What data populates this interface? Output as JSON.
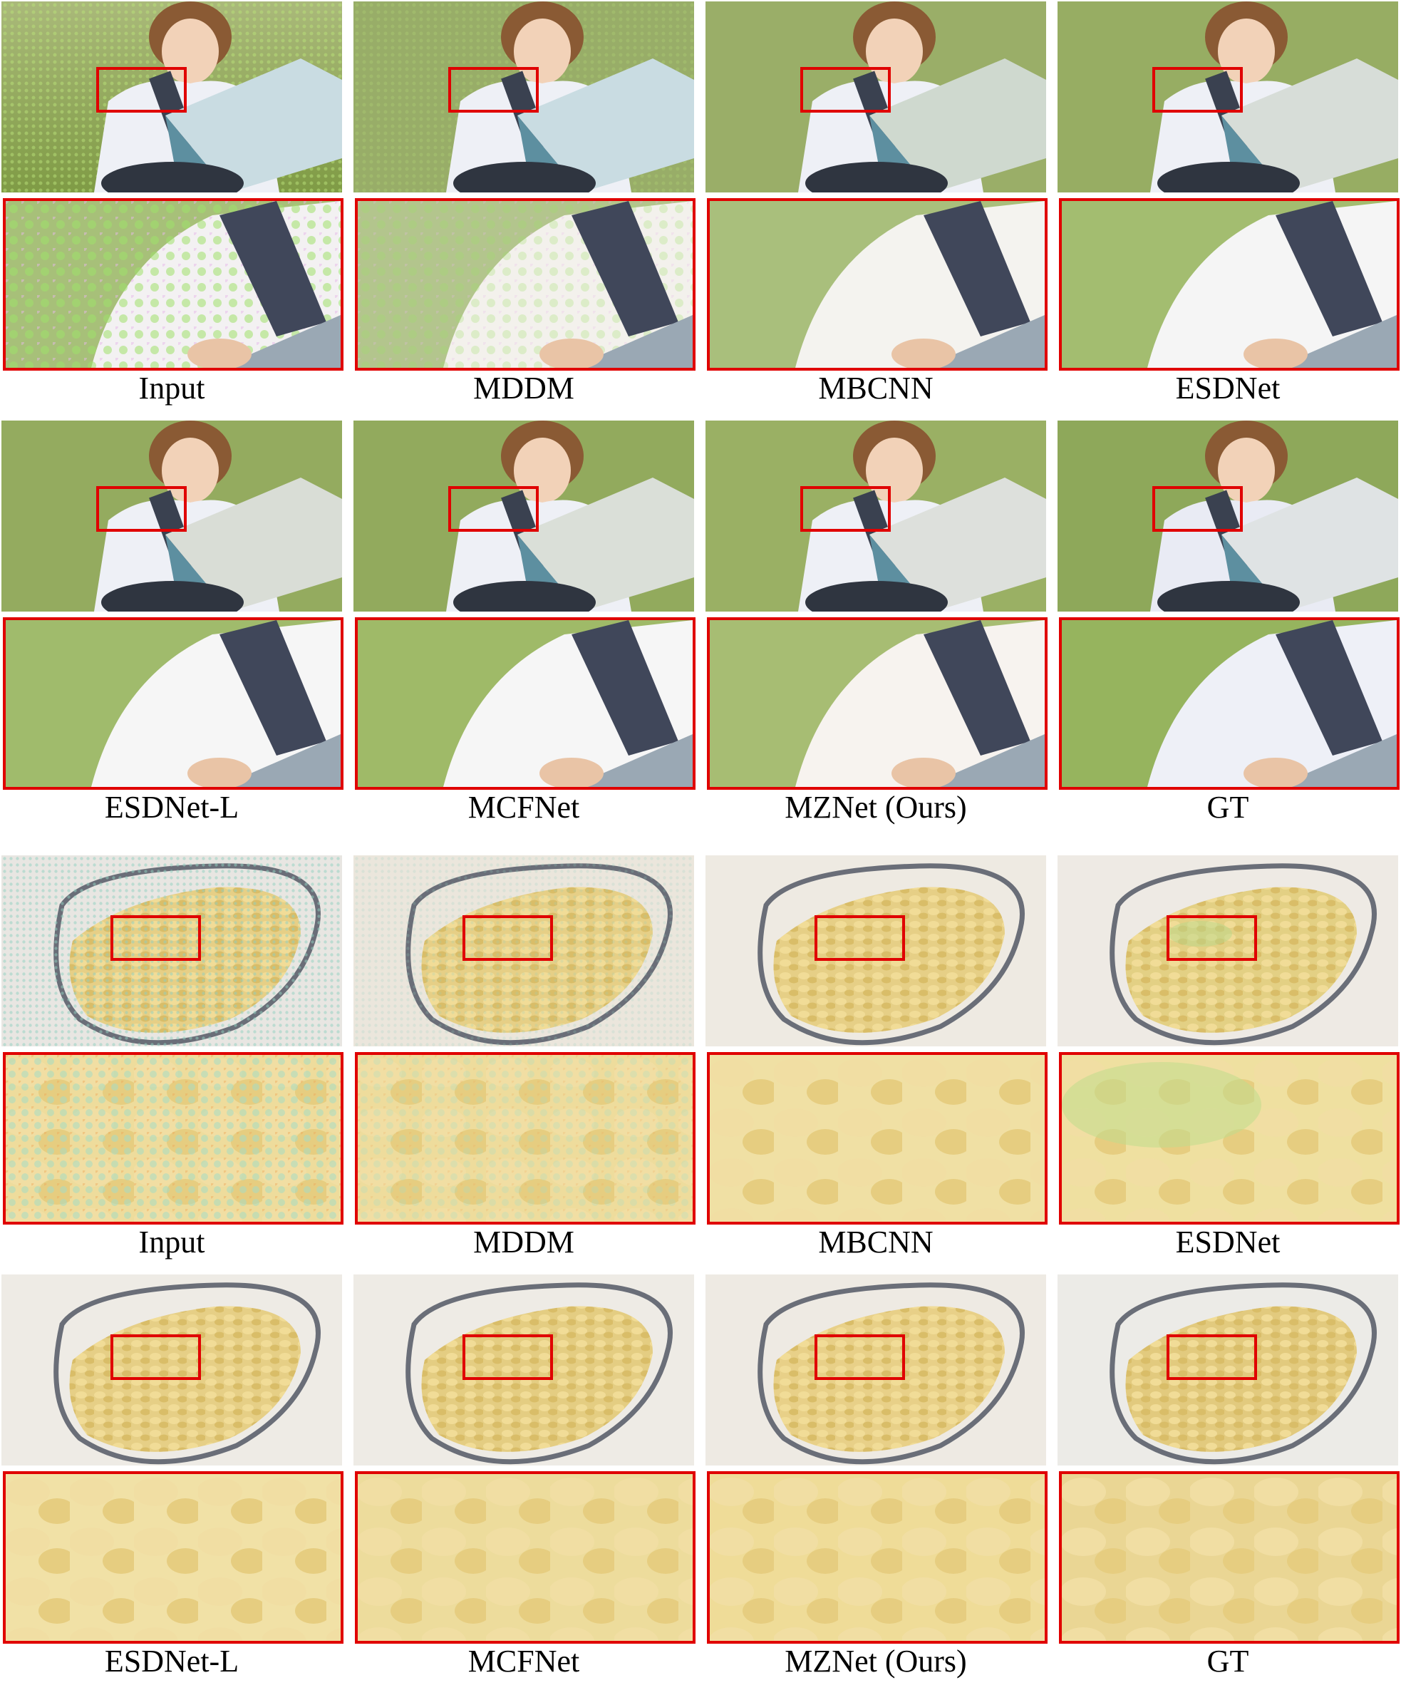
{
  "groups": [
    {
      "scene": "boy reading a book on grass",
      "rows": [
        {
          "labels": [
            "Input",
            "MDDM",
            "MBCNN",
            "ESDNet"
          ]
        },
        {
          "labels": [
            "ESDNet-L",
            "MCFNet",
            "MZNet (Ours)",
            "GT"
          ]
        }
      ]
    },
    {
      "scene": "glass bowl of cooked rice",
      "rows": [
        {
          "labels": [
            "Input",
            "MDDM",
            "MBCNN",
            "ESDNet"
          ]
        },
        {
          "labels": [
            "ESDNet-L",
            "MCFNet",
            "MZNet (Ours)",
            "GT"
          ]
        }
      ]
    }
  ],
  "colors": {
    "highlight_box": "#e00000",
    "grass": "#8fa55a",
    "shirt": "#eef0f6",
    "strap": "#3a4150",
    "rice": "#e6cf86",
    "bowl_rim": "#6a6e78"
  }
}
